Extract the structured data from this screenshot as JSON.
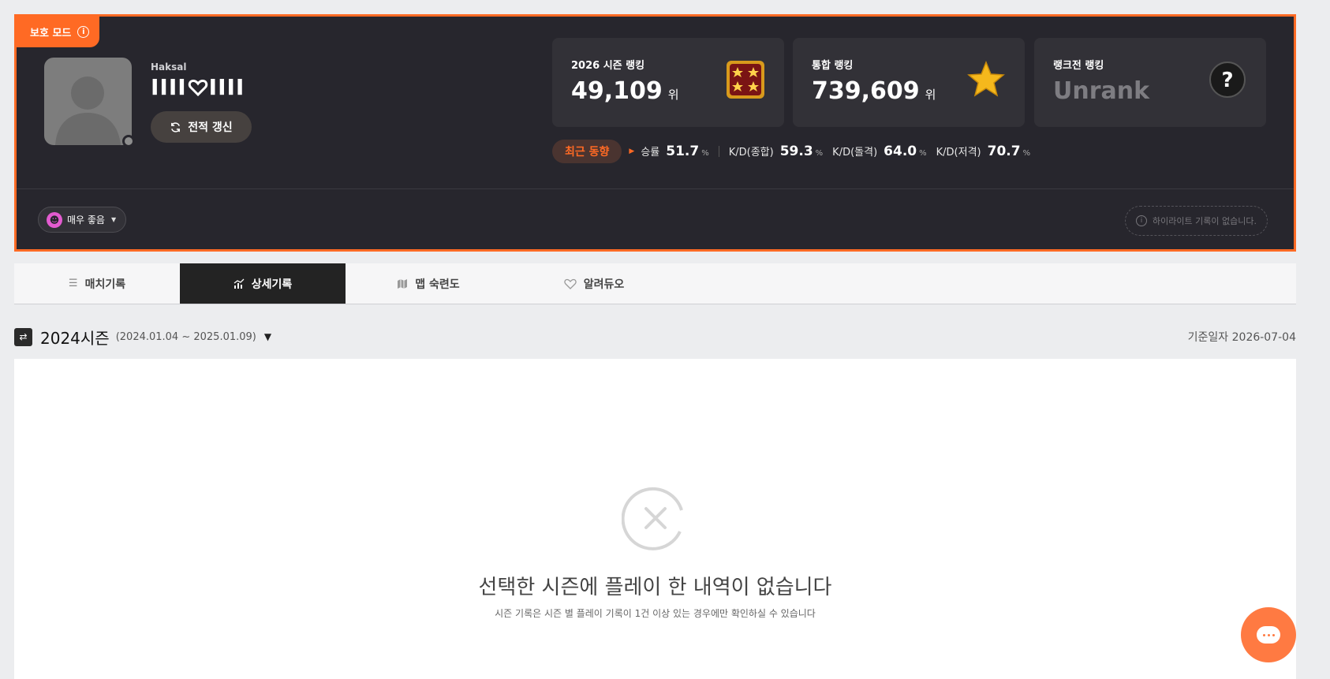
{
  "profile": {
    "protect_mode_label": "보호 모드",
    "protect_info_glyph": "i",
    "clan": "Haksal",
    "nickname_left": "IIII",
    "nickname_right": "IIII",
    "refresh_label": "전적 갱신",
    "rankings": [
      {
        "label": "2026 시즌 랭킹",
        "value": "49,109",
        "unit": "위",
        "emblem": "star-rank-emblem"
      },
      {
        "label": "통합 랭킹",
        "value": "739,609",
        "unit": "위",
        "emblem": "gold-star-icon"
      },
      {
        "label": "랭크전 랭킹",
        "value": "Unrank",
        "unit": "",
        "emblem": "question-icon"
      }
    ],
    "trend": {
      "tag": "최근 동향",
      "winrate_label": "승률",
      "winrate_value": "51.7",
      "winrate_unit": "%",
      "kd_total_label": "K/D(종합)",
      "kd_total_value": "59.3",
      "kd_total_unit": "%",
      "kd_assault_label": "K/D(돌격)",
      "kd_assault_value": "64.0",
      "kd_assault_unit": "%",
      "kd_sniper_label": "K/D(저격)",
      "kd_sniper_value": "70.7",
      "kd_sniper_unit": "%"
    },
    "mood_label": "매우 좋음",
    "highlight_empty": "하이라이트 기록이 없습니다.",
    "highlight_info_glyph": "i"
  },
  "tabs": [
    {
      "label": "매치기록",
      "icon": "list-icon",
      "active": false
    },
    {
      "label": "상세기록",
      "icon": "chart-icon",
      "active": true
    },
    {
      "label": "맵 숙련도",
      "icon": "map-icon",
      "active": false
    },
    {
      "label": "알려듀오",
      "icon": "handshake-icon",
      "active": false
    }
  ],
  "season": {
    "title": "2024시즌",
    "range": "(2024.01.04 ~ 2025.01.09)",
    "base_date": "기준일자 2026-07-04"
  },
  "empty_state": {
    "title": "선택한 시즌에 플레이 한 내역이 없습니다",
    "subtitle": "시즌 기록은 시즌 별 플레이 기록이 1건 이상 있는 경우에만 확인하실 수 있습니다"
  },
  "colors": {
    "accent": "#ff6a24",
    "card_bg": "#27262d",
    "tab_active": "#232323"
  }
}
